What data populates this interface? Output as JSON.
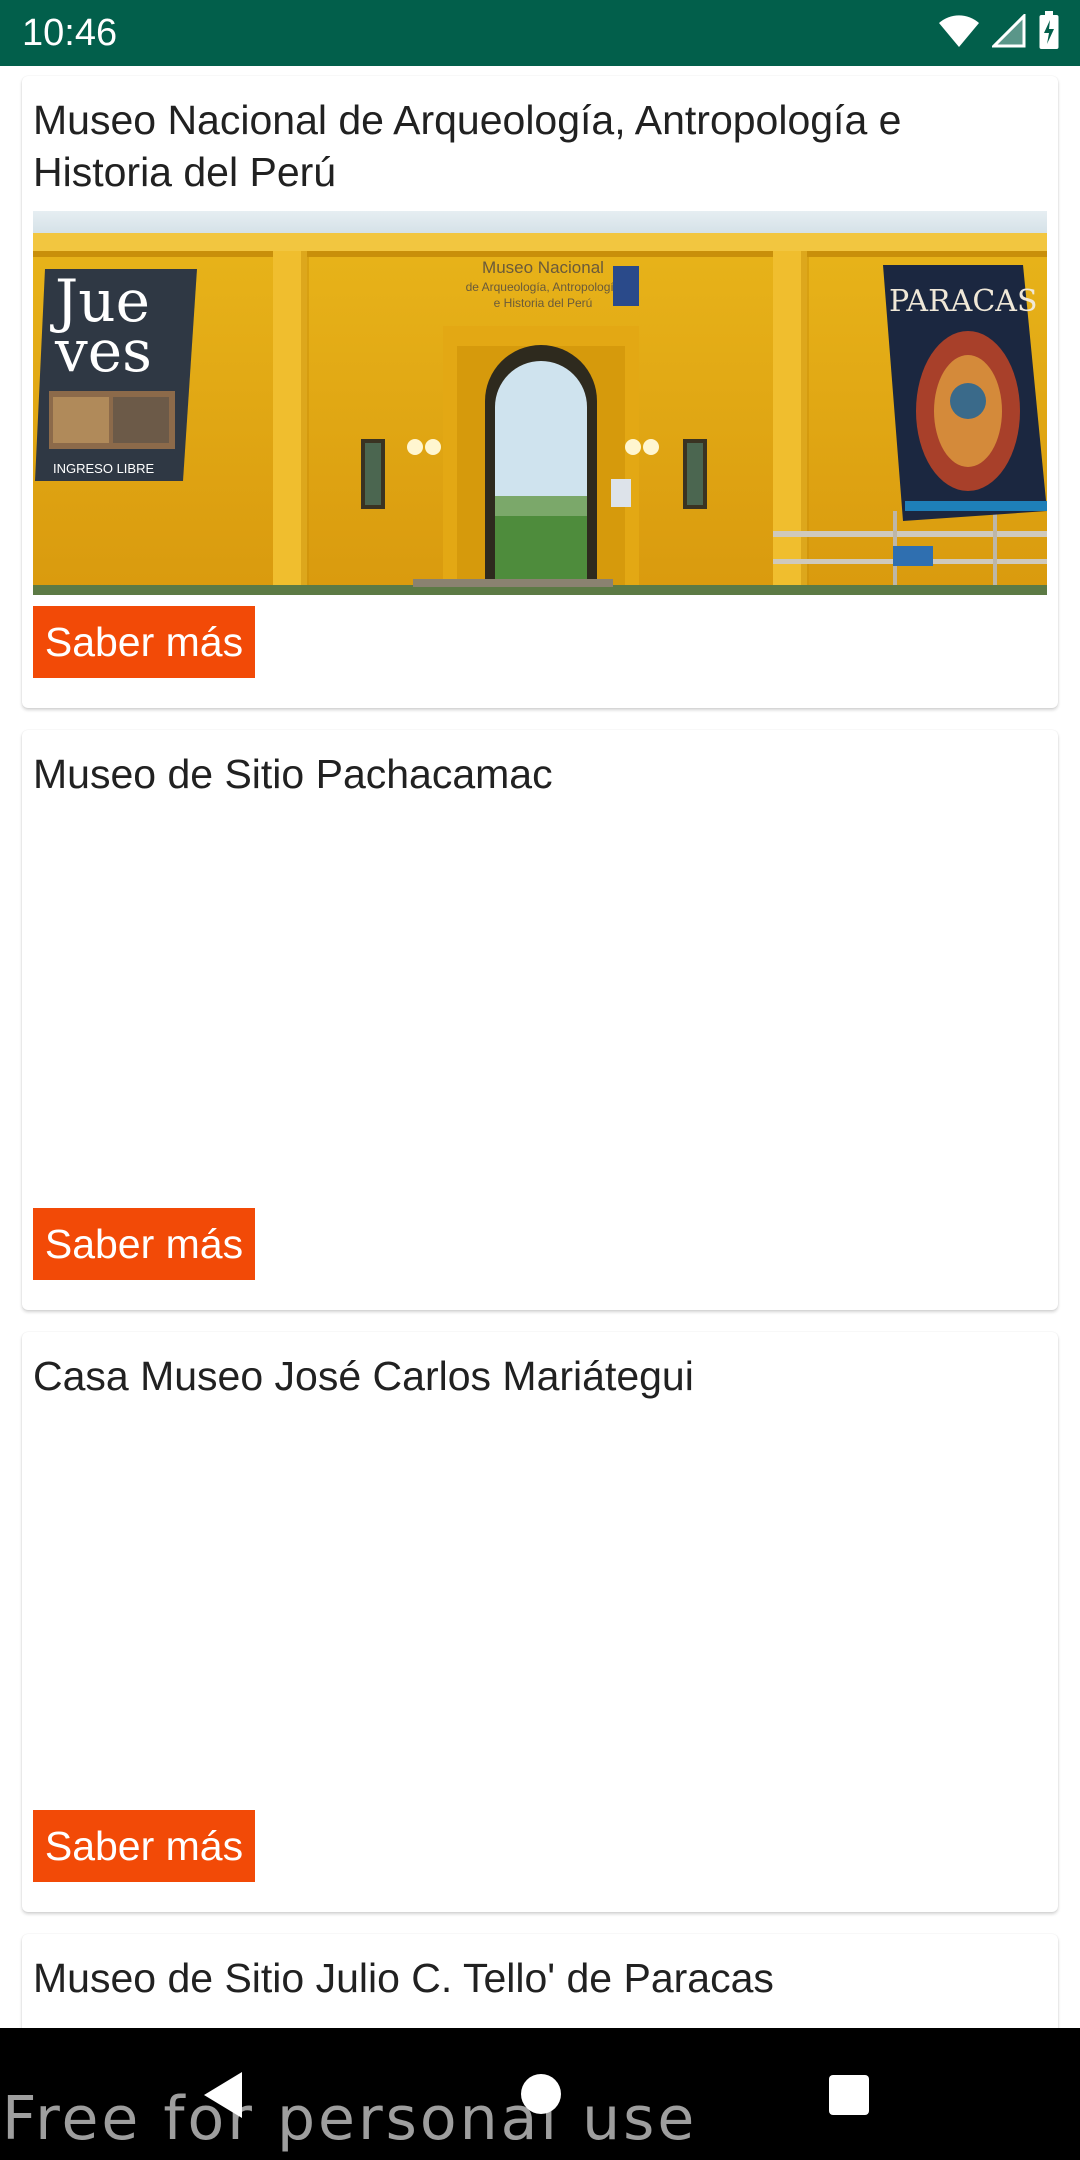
{
  "status_bar": {
    "time": "10:46",
    "background": "#025F4B",
    "icons": [
      "wifi-icon",
      "cell-signal-icon",
      "battery-charging-icon"
    ]
  },
  "accent_color": "#F24A07",
  "museums": [
    {
      "title": "Museo Nacional de Arqueología, Antropología e Historia del Perú",
      "button_label": "Saber más",
      "image_text": {
        "banner_left_line1": "Jue",
        "banner_left_line2": "ves",
        "banner_left_footer": "INGRESO LIBRE",
        "sign_line1": "Museo Nacional",
        "sign_line2": "de Arqueología, Antropología",
        "sign_line3": "e Historia del Perú",
        "banner_right": "PARACAS"
      }
    },
    {
      "title": "Museo de Sitio Pachacamac",
      "button_label": "Saber más"
    },
    {
      "title": "Casa Museo José Carlos Mariátegui",
      "button_label": "Saber más"
    },
    {
      "title": "Museo de Sitio Julio C. Tello' de Paracas"
    }
  ],
  "nav_bar": {
    "icons": [
      "back-icon",
      "home-icon",
      "recents-icon"
    ]
  },
  "watermark": "Free for personal use"
}
